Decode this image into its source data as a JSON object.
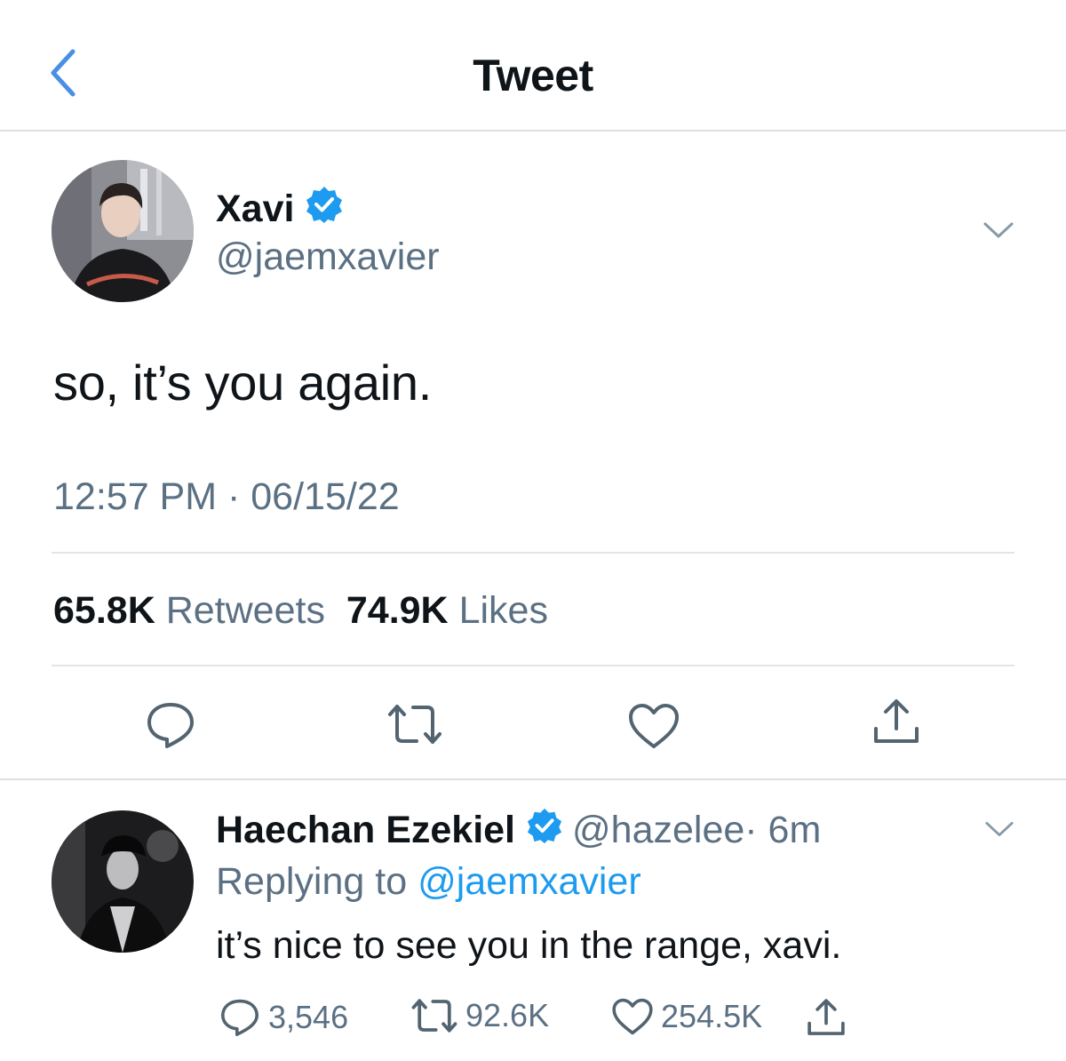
{
  "header": {
    "title": "Tweet"
  },
  "tweet": {
    "name": "Xavi",
    "handle": "@jaemxavier",
    "text": "so, it’s you again.",
    "timestamp": "12:57 PM · 06/15/22",
    "retweets_count": "65.8K",
    "retweets_label": "Retweets",
    "likes_count": "74.9K",
    "likes_label": "Likes"
  },
  "reply": {
    "name": "Haechan Ezekiel",
    "handle_time": "@hazelee· 6m",
    "replying_prefix": "Replying to",
    "replying_handle": "@jaemxavier",
    "text": "it’s nice to see you in the range, xavi.",
    "reply_count": "3,546",
    "retweet_count": "92.6K",
    "like_count": "254.5K"
  },
  "colors": {
    "accent": "#1d9bf0",
    "text": "#0f1419",
    "secondary": "#5b7083",
    "icon": "#536471",
    "divider": "#e1e5e9"
  },
  "icons": [
    "back-chevron-icon",
    "verified-badge-icon",
    "chevron-down-icon",
    "reply-icon",
    "retweet-icon",
    "like-icon",
    "share-icon"
  ]
}
